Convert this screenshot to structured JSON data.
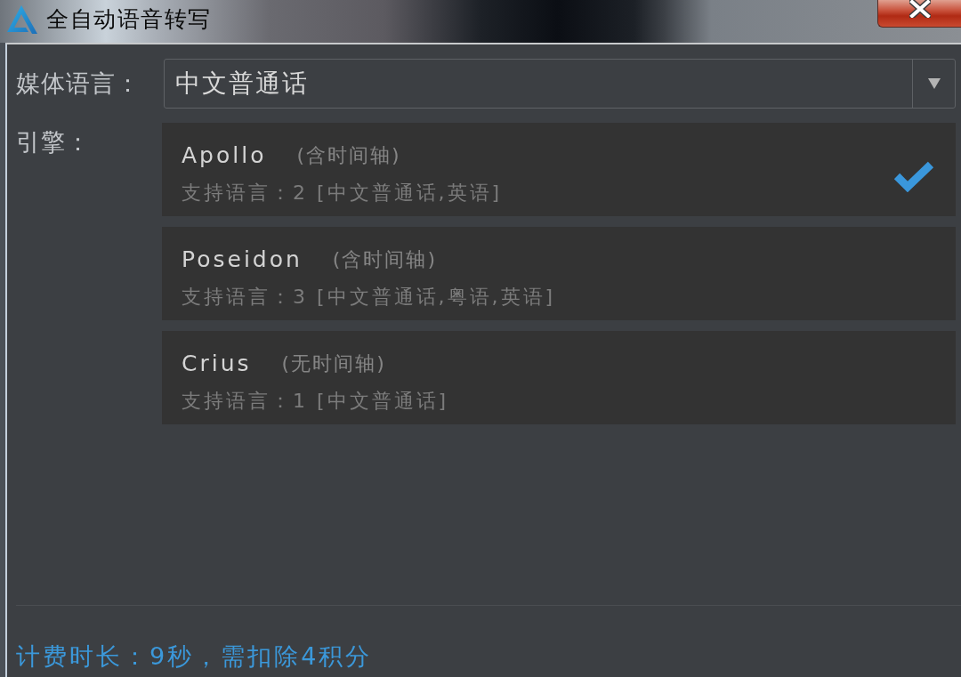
{
  "window": {
    "title": "全自动语音转写"
  },
  "media_language": {
    "label": "媒体语言：",
    "value": "中文普通话"
  },
  "engine": {
    "label": "引擎：",
    "items": [
      {
        "name": "Apollo",
        "tag": "(含时间轴)",
        "languages": "支持语言：2 [中文普通话,英语]",
        "selected": true
      },
      {
        "name": "Poseidon",
        "tag": "(含时间轴)",
        "languages": "支持语言：3 [中文普通话,粤语,英语]",
        "selected": false
      },
      {
        "name": "Crius",
        "tag": "(无时间轴)",
        "languages": "支持语言：1 [中文普通话]",
        "selected": false
      }
    ]
  },
  "status_bar": {
    "text": "计费时长：9秒，需扣除4积分"
  }
}
